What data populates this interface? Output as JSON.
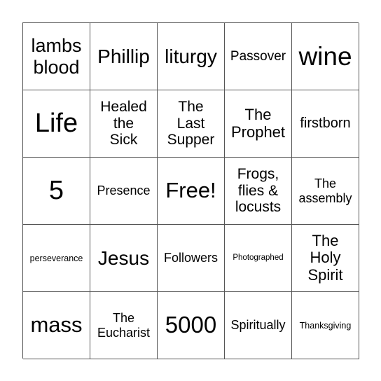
{
  "cells": [
    "lambs\nblood",
    "Phillip",
    "liturgy",
    "Passover",
    "wine",
    "Life",
    "Healed\nthe\nSick",
    "The\nLast\nSupper",
    "The\nProphet",
    "firstborn",
    "5",
    "Presence",
    "Free!",
    "Frogs,\nflies &\nlocusts",
    "The\nassembly",
    "perseverance",
    "Jesus",
    "Followers",
    "Photographed",
    "The\nHoly\nSpirit",
    "mass",
    "The\nEucharist",
    "5000",
    "Spiritually",
    "Thanksgiving"
  ]
}
